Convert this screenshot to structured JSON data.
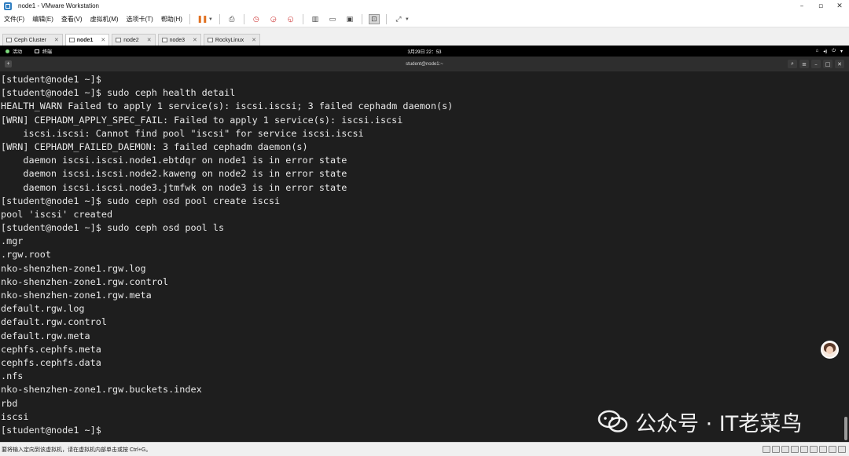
{
  "window": {
    "title": "node1 - VMware Workstation",
    "controls": [
      "–",
      "▫",
      "✕"
    ]
  },
  "menu": {
    "items": [
      "文件(F)",
      "编辑(E)",
      "查看(V)",
      "虚拟机(M)",
      "选项卡(T)",
      "帮助(H)"
    ]
  },
  "tabs": [
    {
      "label": "Ceph Cluster",
      "active": false
    },
    {
      "label": "node1",
      "active": true
    },
    {
      "label": "node2",
      "active": false
    },
    {
      "label": "node3",
      "active": false
    },
    {
      "label": "RockyLinux",
      "active": false
    }
  ],
  "gnome": {
    "activities": "活动",
    "app": "终端",
    "clock": "3月29日 22：53",
    "sys_icons": [
      "network-icon",
      "volume-icon",
      "power-icon",
      "menu-arrow-icon"
    ]
  },
  "terminal_header": {
    "title": "student@node1:~"
  },
  "terminal": {
    "lines": [
      "[student@node1 ~]$",
      "[student@node1 ~]$ sudo ceph health detail",
      "HEALTH_WARN Failed to apply 1 service(s): iscsi.iscsi; 3 failed cephadm daemon(s)",
      "[WRN] CEPHADM_APPLY_SPEC_FAIL: Failed to apply 1 service(s): iscsi.iscsi",
      "    iscsi.iscsi: Cannot find pool \"iscsi\" for service iscsi.iscsi",
      "[WRN] CEPHADM_FAILED_DAEMON: 3 failed cephadm daemon(s)",
      "    daemon iscsi.iscsi.node1.ebtdqr on node1 is in error state",
      "    daemon iscsi.iscsi.node2.kaweng on node2 is in error state",
      "    daemon iscsi.iscsi.node3.jtmfwk on node3 is in error state",
      "[student@node1 ~]$ sudo ceph osd pool create iscsi",
      "pool 'iscsi' created",
      "[student@node1 ~]$ sudo ceph osd pool ls",
      ".mgr",
      ".rgw.root",
      "nko-shenzhen-zone1.rgw.log",
      "nko-shenzhen-zone1.rgw.control",
      "nko-shenzhen-zone1.rgw.meta",
      "default.rgw.log",
      "default.rgw.control",
      "default.rgw.meta",
      "cephfs.cephfs.meta",
      "cephfs.cephfs.data",
      ".nfs",
      "nko-shenzhen-zone1.rgw.buckets.index",
      "rbd",
      "iscsi",
      "[student@node1 ~]$"
    ]
  },
  "watermark": {
    "text": "公众号 · IT老菜鸟"
  },
  "status": {
    "hint": "要将输入定向到该虚拟机，请在虚拟机内部单击或按 Ctrl+G。"
  },
  "colors": {
    "terminal_bg": "#1e1e1e",
    "terminal_fg": "#e8e8e8",
    "pause_accent": "#e07020"
  }
}
